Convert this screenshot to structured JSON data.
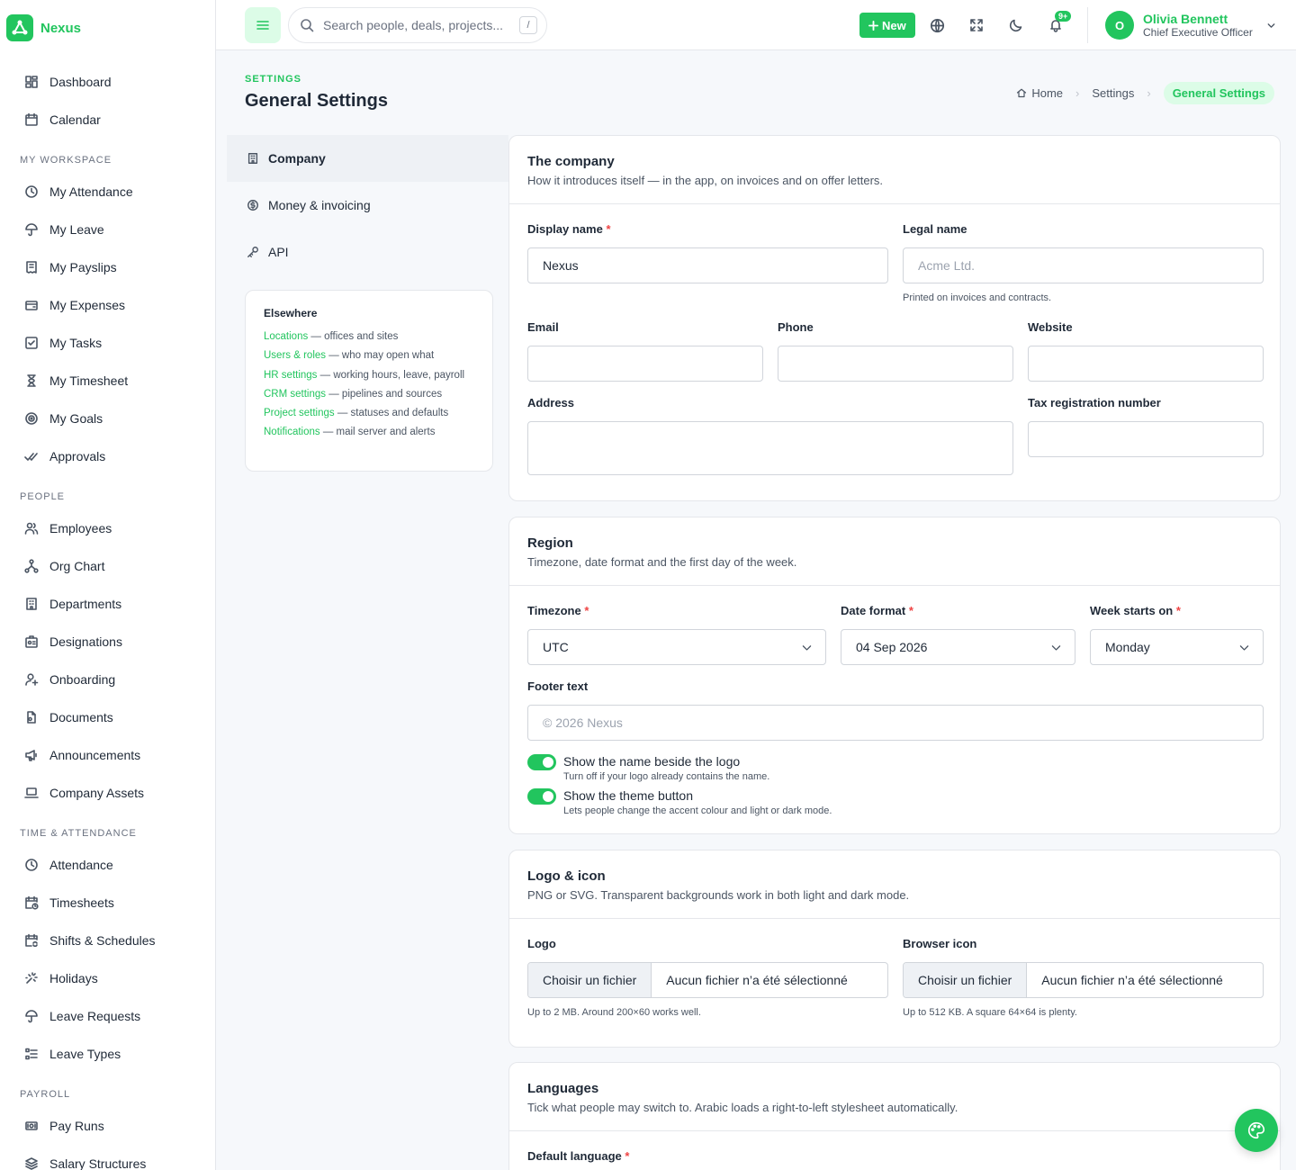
{
  "app": {
    "name": "Nexus"
  },
  "sidebar": {
    "top": [
      {
        "label": "Dashboard",
        "icon": "dashboard-icon"
      },
      {
        "label": "Calendar",
        "icon": "calendar-icon"
      }
    ],
    "sections": [
      {
        "title": "My Workspace",
        "items": [
          {
            "label": "My Attendance",
            "icon": "clock-icon"
          },
          {
            "label": "My Leave",
            "icon": "umbrella-icon"
          },
          {
            "label": "My Payslips",
            "icon": "receipt-icon"
          },
          {
            "label": "My Expenses",
            "icon": "wallet-icon"
          },
          {
            "label": "My Tasks",
            "icon": "checkbox-icon"
          },
          {
            "label": "My Timesheet",
            "icon": "hourglass-icon"
          },
          {
            "label": "My Goals",
            "icon": "target-icon"
          },
          {
            "label": "Approvals",
            "icon": "double-check-icon"
          }
        ]
      },
      {
        "title": "People",
        "items": [
          {
            "label": "Employees",
            "icon": "users-icon"
          },
          {
            "label": "Org Chart",
            "icon": "org-chart-icon"
          },
          {
            "label": "Departments",
            "icon": "building-icon"
          },
          {
            "label": "Designations",
            "icon": "id-badge-icon"
          },
          {
            "label": "Onboarding",
            "icon": "user-plus-icon"
          },
          {
            "label": "Documents",
            "icon": "document-icon"
          },
          {
            "label": "Announcements",
            "icon": "megaphone-icon"
          },
          {
            "label": "Company Assets",
            "icon": "laptop-icon"
          }
        ]
      },
      {
        "title": "Time & Attendance",
        "items": [
          {
            "label": "Attendance",
            "icon": "clock-icon"
          },
          {
            "label": "Timesheets",
            "icon": "calendar-clock-icon"
          },
          {
            "label": "Shifts & Schedules",
            "icon": "calendar-cycle-icon"
          },
          {
            "label": "Holidays",
            "icon": "sparkle-icon"
          },
          {
            "label": "Leave Requests",
            "icon": "umbrella-icon"
          },
          {
            "label": "Leave Types",
            "icon": "list-icon"
          }
        ]
      },
      {
        "title": "Payroll",
        "items": [
          {
            "label": "Pay Runs",
            "icon": "cash-icon"
          },
          {
            "label": "Salary Structures",
            "icon": "layers-icon"
          }
        ]
      }
    ]
  },
  "topbar": {
    "search_placeholder": "Search people, deals, projects...",
    "search_shortcut": "/",
    "new_label": "New",
    "notifications_badge": "9+",
    "user": {
      "initial": "O",
      "name": "Olivia Bennett",
      "role": "Chief Executive Officer"
    }
  },
  "header": {
    "eyebrow": "SETTINGS",
    "title": "General Settings",
    "breadcrumb": [
      "Home",
      "Settings",
      "General Settings"
    ]
  },
  "settings_nav": [
    {
      "label": "Company",
      "icon": "building-icon",
      "active": true
    },
    {
      "label": "Money & invoicing",
      "icon": "coin-icon",
      "active": false
    },
    {
      "label": "API",
      "icon": "key-icon",
      "active": false
    }
  ],
  "elsewhere": {
    "title": "Elsewhere",
    "links": [
      {
        "link": "Locations",
        "desc": " — offices and sites"
      },
      {
        "link": "Users & roles",
        "desc": " — who may open what"
      },
      {
        "link": "HR settings",
        "desc": " — working hours, leave, payroll"
      },
      {
        "link": "CRM settings",
        "desc": " — pipelines and sources"
      },
      {
        "link": "Project settings",
        "desc": " — statuses and defaults"
      },
      {
        "link": "Notifications",
        "desc": " — mail server and alerts"
      }
    ]
  },
  "company": {
    "title": "The company",
    "subtitle": "How it introduces itself — in the app, on invoices and on offer letters.",
    "display_name": {
      "label": "Display name",
      "value": "Nexus"
    },
    "legal_name": {
      "label": "Legal name",
      "placeholder": "Acme Ltd.",
      "help": "Printed on invoices and contracts."
    },
    "email": {
      "label": "Email",
      "value": ""
    },
    "phone": {
      "label": "Phone",
      "value": ""
    },
    "website": {
      "label": "Website",
      "value": ""
    },
    "address": {
      "label": "Address",
      "value": ""
    },
    "tax": {
      "label": "Tax registration number",
      "value": ""
    }
  },
  "region": {
    "title": "Region",
    "subtitle": "Timezone, date format and the first day of the week.",
    "timezone": {
      "label": "Timezone",
      "value": "UTC"
    },
    "date_format": {
      "label": "Date format",
      "value": "04 Sep 2026"
    },
    "week_start": {
      "label": "Week starts on",
      "value": "Monday"
    },
    "footer": {
      "label": "Footer text",
      "placeholder": "© 2026 Nexus"
    },
    "toggle_name": {
      "label": "Show the name beside the logo",
      "help": "Turn off if your logo already contains the name.",
      "on": true
    },
    "toggle_theme": {
      "label": "Show the theme button",
      "help": "Lets people change the accent colour and light or dark mode.",
      "on": true
    }
  },
  "logo": {
    "title": "Logo & icon",
    "subtitle": "PNG or SVG. Transparent backgrounds work in both light and dark mode.",
    "logo_field": {
      "label": "Logo",
      "button": "Choisir un fichier",
      "file": "Aucun fichier n’a été sélectionné",
      "help": "Up to 2 MB. Around 200×60 works well."
    },
    "icon_field": {
      "label": "Browser icon",
      "button": "Choisir un fichier",
      "file": "Aucun fichier n’a été sélectionné",
      "help": "Up to 512 KB. A square 64×64 is plenty."
    }
  },
  "languages": {
    "title": "Languages",
    "subtitle": "Tick what people may switch to. Arabic loads a right-to-left stylesheet automatically.",
    "default_label": "Default language"
  },
  "colors": {
    "accent": "#22c55e",
    "accent_soft": "#dcfce7",
    "required": "#ef4444"
  }
}
